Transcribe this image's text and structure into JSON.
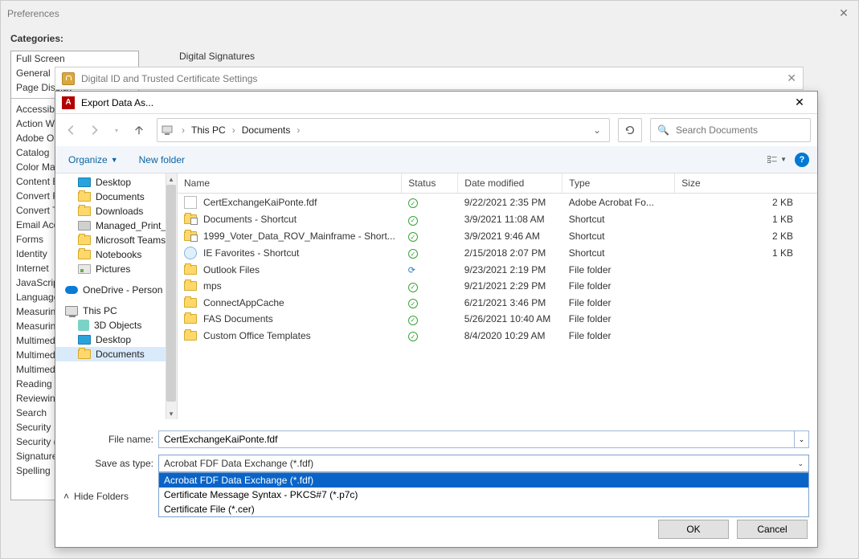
{
  "prefs": {
    "title": "Preferences",
    "categoriesLabel": "Categories:",
    "sectionHeading": "Digital Signatures",
    "categories": [
      "Full Screen",
      "General",
      "Page Display",
      "---",
      "Accessibility",
      "Action Wizard",
      "Adobe Online",
      "Catalog",
      "Color Management",
      "Content Editing",
      "Convert From",
      "Convert To",
      "Email Accounts",
      "Forms",
      "Identity",
      "Internet",
      "JavaScript",
      "Language",
      "Measuring",
      "Measuring (2D)",
      "Multimedia",
      "Multimedia (Legacy)",
      "Multimedia Trust",
      "Reading",
      "Reviewing",
      "Search",
      "Security",
      "Security (Enhanced)",
      "Signatures",
      "Spelling"
    ]
  },
  "trusted": {
    "title": "Digital ID and Trusted Certificate Settings"
  },
  "export": {
    "title": "Export Data As...",
    "breadcrumb": {
      "root": "This PC",
      "folder": "Documents"
    },
    "search": {
      "placeholder": "Search Documents"
    },
    "toolbar": {
      "organize": "Organize",
      "newFolder": "New folder"
    },
    "tree": [
      {
        "icon": "desktop",
        "label": "Desktop",
        "indent": 2
      },
      {
        "icon": "folder",
        "label": "Documents",
        "indent": 2
      },
      {
        "icon": "folder",
        "label": "Downloads",
        "indent": 2
      },
      {
        "icon": "printer",
        "label": "Managed_Print_",
        "indent": 2
      },
      {
        "icon": "folder",
        "label": "Microsoft Teams",
        "indent": 2
      },
      {
        "icon": "folder",
        "label": "Notebooks",
        "indent": 2
      },
      {
        "icon": "pic",
        "label": "Pictures",
        "indent": 2
      },
      {
        "icon": "onedrive",
        "label": "OneDrive - Person",
        "indent": 1
      },
      {
        "icon": "pc",
        "label": "This PC",
        "indent": 1
      },
      {
        "icon": "cube",
        "label": "3D Objects",
        "indent": 2
      },
      {
        "icon": "desktop",
        "label": "Desktop",
        "indent": 2
      },
      {
        "icon": "folder",
        "label": "Documents",
        "indent": 2,
        "selected": true
      }
    ],
    "columns": {
      "name": "Name",
      "status": "Status",
      "date": "Date modified",
      "type": "Type",
      "size": "Size"
    },
    "files": [
      {
        "icon": "fdf",
        "name": "CertExchangeKaiPonte.fdf",
        "status": "ok",
        "date": "9/22/2021 2:35 PM",
        "type": "Adobe Acrobat Fo...",
        "size": "2 KB"
      },
      {
        "icon": "shortcut",
        "name": "Documents - Shortcut",
        "status": "ok",
        "date": "3/9/2021 11:08 AM",
        "type": "Shortcut",
        "size": "1 KB"
      },
      {
        "icon": "shortcut",
        "name": "1999_Voter_Data_ROV_Mainframe - Short...",
        "status": "ok",
        "date": "3/9/2021 9:46 AM",
        "type": "Shortcut",
        "size": "2 KB"
      },
      {
        "icon": "ie",
        "name": "IE Favorites - Shortcut",
        "status": "ok",
        "date": "2/15/2018 2:07 PM",
        "type": "Shortcut",
        "size": "1 KB"
      },
      {
        "icon": "folder",
        "name": "Outlook Files",
        "status": "sync",
        "date": "9/23/2021 2:19 PM",
        "type": "File folder",
        "size": ""
      },
      {
        "icon": "folder",
        "name": "mps",
        "status": "ok",
        "date": "9/21/2021 2:29 PM",
        "type": "File folder",
        "size": ""
      },
      {
        "icon": "folder",
        "name": "ConnectAppCache",
        "status": "ok",
        "date": "6/21/2021 3:46 PM",
        "type": "File folder",
        "size": ""
      },
      {
        "icon": "folder",
        "name": "FAS Documents",
        "status": "ok",
        "date": "5/26/2021 10:40 AM",
        "type": "File folder",
        "size": ""
      },
      {
        "icon": "folder",
        "name": "Custom Office Templates",
        "status": "ok",
        "date": "8/4/2020 10:29 AM",
        "type": "File folder",
        "size": ""
      }
    ],
    "fileNameLabel": "File name:",
    "fileNameValue": "CertExchangeKaiPonte.fdf",
    "saveTypeLabel": "Save as type:",
    "saveTypeValue": "Acrobat FDF Data Exchange (*.fdf)",
    "saveTypeOptions": [
      "Acrobat FDF Data Exchange (*.fdf)",
      "Certificate Message Syntax - PKCS#7 (*.p7c)",
      "Certificate File (*.cer)"
    ],
    "hideFolders": "Hide Folders",
    "ok": "OK",
    "cancel": "Cancel"
  }
}
